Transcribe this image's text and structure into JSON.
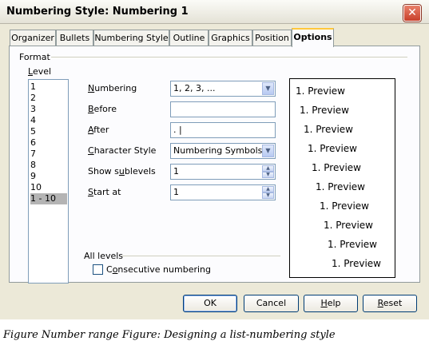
{
  "window": {
    "title": "Numbering Style: Numbering 1",
    "close_glyph": "✕"
  },
  "tabs": [
    "Organizer",
    "Bullets",
    "Numbering Style",
    "Outline",
    "Graphics",
    "Position",
    "Options"
  ],
  "active_tab": "Options",
  "format": {
    "group_label": "Format",
    "level_label": "Level",
    "levels": [
      "1",
      "2",
      "3",
      "4",
      "5",
      "6",
      "7",
      "8",
      "9",
      "10",
      "1 - 10"
    ],
    "selected_level": "1 - 10",
    "numbering": {
      "label": "Numbering",
      "value": "1, 2, 3, ..."
    },
    "before": {
      "label": "Before",
      "value": ""
    },
    "after": {
      "label": "After",
      "value": ". |"
    },
    "character_style": {
      "label": "Character Style",
      "value": "Numbering Symbols"
    },
    "show_sublevels": {
      "label": "Show sublevels",
      "value": "1"
    },
    "start_at": {
      "label": "Start at",
      "value": "1"
    }
  },
  "preview_lines": [
    "1. Preview",
    "1. Preview",
    "1. Preview",
    "1. Preview",
    "1. Preview",
    "1. Preview",
    "1. Preview",
    "1. Preview",
    "1. Preview",
    "1. Preview"
  ],
  "all_levels": {
    "label": "All levels",
    "consecutive_numbering": "Consecutive numbering",
    "checked": false
  },
  "buttons": {
    "ok": "OK",
    "cancel": "Cancel",
    "help": "Help",
    "reset": "Reset"
  },
  "caption": "Figure Number range Figure: Designing a list-numbering style",
  "colors": {
    "panel_bg": "#fcfcfe",
    "dialog_bg": "#ece9d8",
    "active_tab_accent": "#ffc83c",
    "close_button": "#c8402a"
  },
  "icons": {
    "dropdown": "chevron-down-icon",
    "spin": "spin-updown-icon",
    "close": "close-icon"
  }
}
